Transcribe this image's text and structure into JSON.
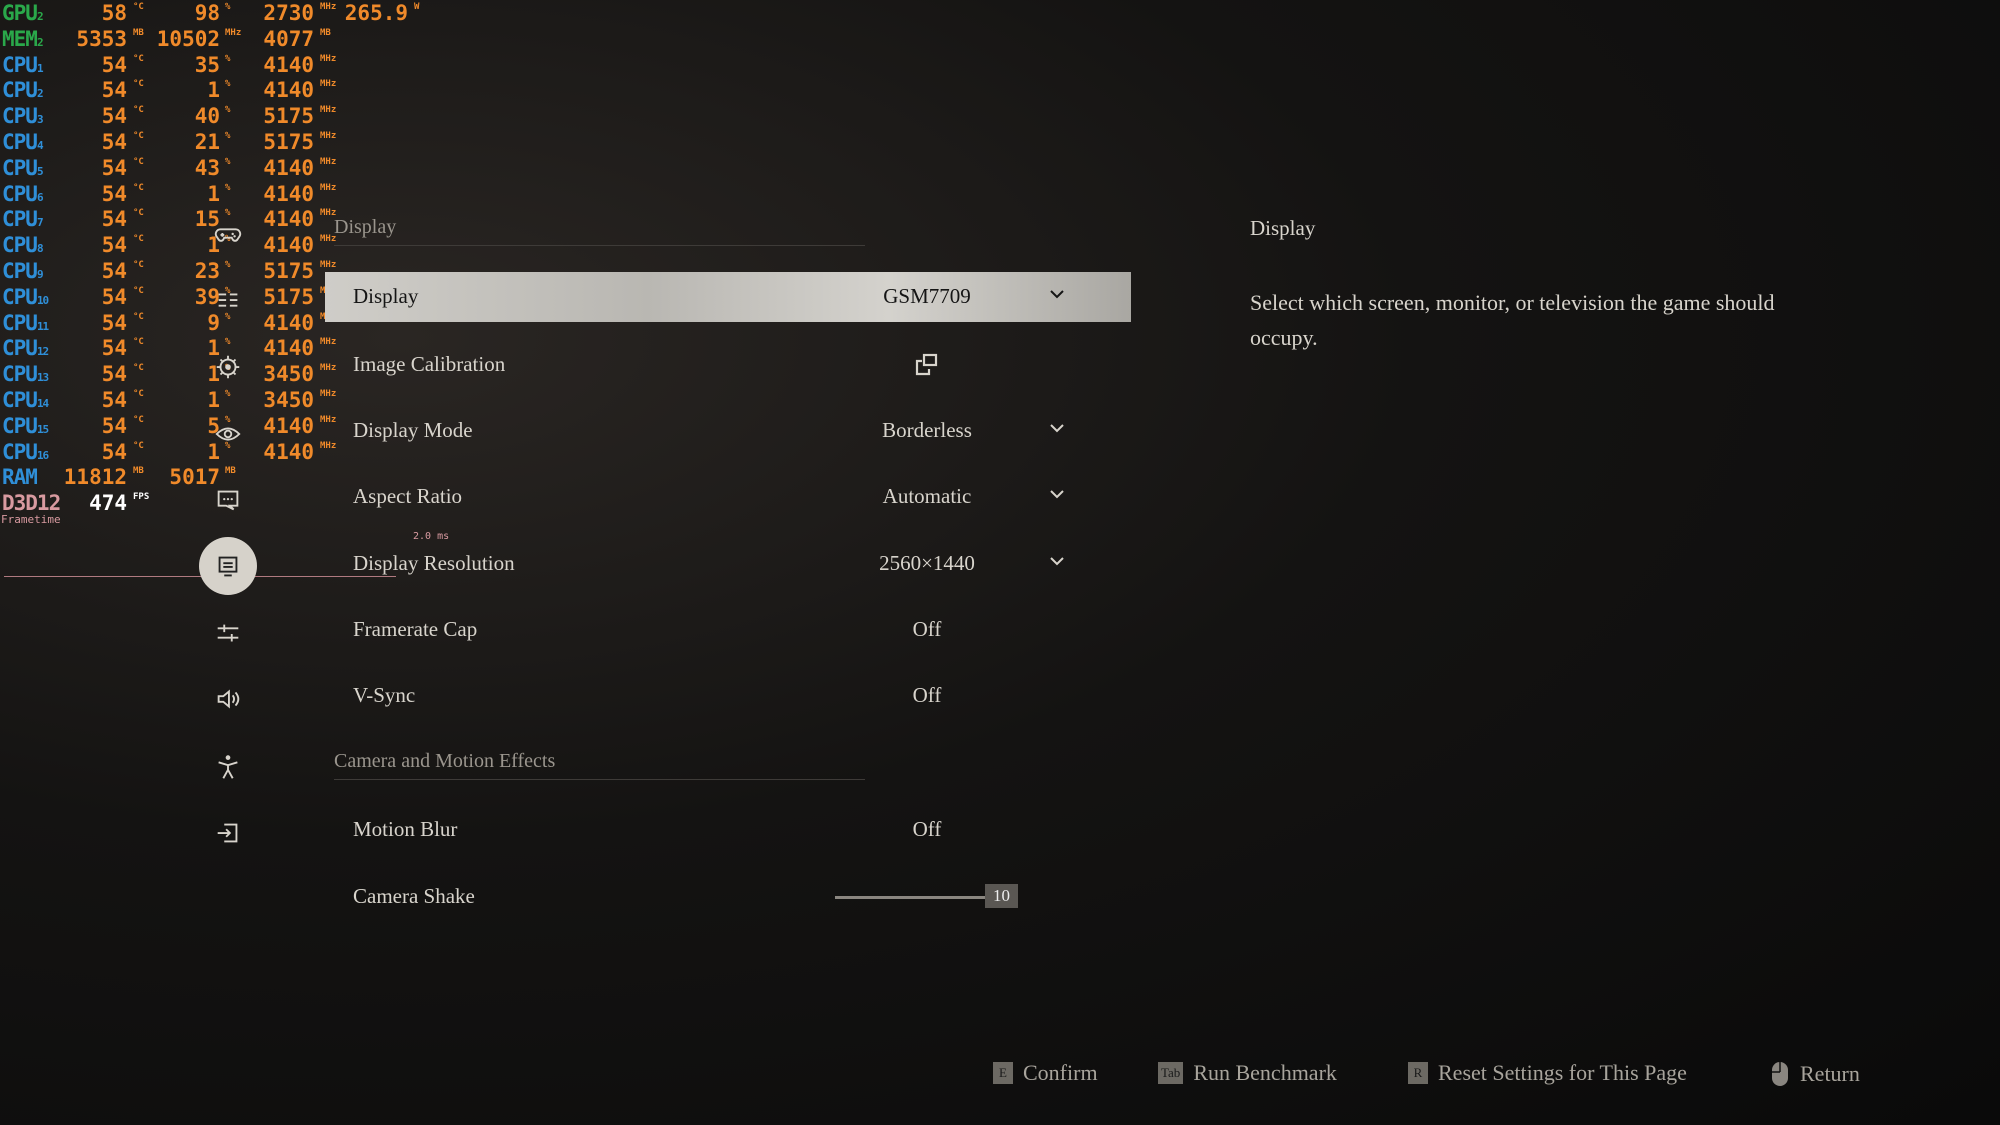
{
  "overlay": {
    "rows": [
      {
        "label": "GPU",
        "sub": "2",
        "label_color": "#2aa84a",
        "cols": [
          [
            "58",
            "°C"
          ],
          [
            "98",
            "%"
          ],
          [
            "2730",
            "MHz"
          ],
          [
            "265.9",
            "W"
          ]
        ]
      },
      {
        "label": "MEM",
        "sub": "2",
        "label_color": "#2aa84a",
        "cols": [
          [
            "5353",
            "MB"
          ],
          [
            "10502",
            "MHz"
          ],
          [
            "4077",
            "MB"
          ]
        ]
      },
      {
        "label": "CPU",
        "sub": "1",
        "label_color": "#2f8fd8",
        "cols": [
          [
            "54",
            "°C"
          ],
          [
            "35",
            "%"
          ],
          [
            "4140",
            "MHz"
          ]
        ]
      },
      {
        "label": "CPU",
        "sub": "2",
        "label_color": "#2f8fd8",
        "cols": [
          [
            "54",
            "°C"
          ],
          [
            "1",
            "%"
          ],
          [
            "4140",
            "MHz"
          ]
        ]
      },
      {
        "label": "CPU",
        "sub": "3",
        "label_color": "#2f8fd8",
        "cols": [
          [
            "54",
            "°C"
          ],
          [
            "40",
            "%"
          ],
          [
            "5175",
            "MHz"
          ]
        ]
      },
      {
        "label": "CPU",
        "sub": "4",
        "label_color": "#2f8fd8",
        "cols": [
          [
            "54",
            "°C"
          ],
          [
            "21",
            "%"
          ],
          [
            "5175",
            "MHz"
          ]
        ]
      },
      {
        "label": "CPU",
        "sub": "5",
        "label_color": "#2f8fd8",
        "cols": [
          [
            "54",
            "°C"
          ],
          [
            "43",
            "%"
          ],
          [
            "4140",
            "MHz"
          ]
        ]
      },
      {
        "label": "CPU",
        "sub": "6",
        "label_color": "#2f8fd8",
        "cols": [
          [
            "54",
            "°C"
          ],
          [
            "1",
            "%"
          ],
          [
            "4140",
            "MHz"
          ]
        ]
      },
      {
        "label": "CPU",
        "sub": "7",
        "label_color": "#2f8fd8",
        "cols": [
          [
            "54",
            "°C"
          ],
          [
            "15",
            "%"
          ],
          [
            "4140",
            "MHz"
          ]
        ]
      },
      {
        "label": "CPU",
        "sub": "8",
        "label_color": "#2f8fd8",
        "cols": [
          [
            "54",
            "°C"
          ],
          [
            "1",
            "%"
          ],
          [
            "4140",
            "MHz"
          ]
        ]
      },
      {
        "label": "CPU",
        "sub": "9",
        "label_color": "#2f8fd8",
        "cols": [
          [
            "54",
            "°C"
          ],
          [
            "23",
            "%"
          ],
          [
            "5175",
            "MHz"
          ]
        ]
      },
      {
        "label": "CPU",
        "sub": "10",
        "label_color": "#2f8fd8",
        "cols": [
          [
            "54",
            "°C"
          ],
          [
            "39",
            "%"
          ],
          [
            "5175",
            "MHz"
          ]
        ]
      },
      {
        "label": "CPU",
        "sub": "11",
        "label_color": "#2f8fd8",
        "cols": [
          [
            "54",
            "°C"
          ],
          [
            "9",
            "%"
          ],
          [
            "4140",
            "MHz"
          ]
        ]
      },
      {
        "label": "CPU",
        "sub": "12",
        "label_color": "#2f8fd8",
        "cols": [
          [
            "54",
            "°C"
          ],
          [
            "1",
            "%"
          ],
          [
            "4140",
            "MHz"
          ]
        ]
      },
      {
        "label": "CPU",
        "sub": "13",
        "label_color": "#2f8fd8",
        "cols": [
          [
            "54",
            "°C"
          ],
          [
            "1",
            "%"
          ],
          [
            "3450",
            "MHz"
          ]
        ]
      },
      {
        "label": "CPU",
        "sub": "14",
        "label_color": "#2f8fd8",
        "cols": [
          [
            "54",
            "°C"
          ],
          [
            "1",
            "%"
          ],
          [
            "3450",
            "MHz"
          ]
        ]
      },
      {
        "label": "CPU",
        "sub": "15",
        "label_color": "#2f8fd8",
        "cols": [
          [
            "54",
            "°C"
          ],
          [
            "5",
            "%"
          ],
          [
            "4140",
            "MHz"
          ]
        ]
      },
      {
        "label": "CPU",
        "sub": "16",
        "label_color": "#2f8fd8",
        "cols": [
          [
            "54",
            "°C"
          ],
          [
            "1",
            "%"
          ],
          [
            "4140",
            "MHz"
          ]
        ]
      },
      {
        "label": "RAM",
        "sub": "",
        "label_color": "#2f8fd8",
        "cols": [
          [
            "11812",
            "MB"
          ],
          [
            "5017",
            "MB"
          ]
        ]
      },
      {
        "label": "D3D12",
        "sub": "",
        "label_color": "#d89aa0",
        "cols": [
          [
            "474",
            "FPS"
          ]
        ],
        "white": true
      }
    ],
    "frametime_label": "Frametime",
    "frametime_value": "2.0 ms"
  },
  "sidebar": {
    "icons": [
      "gamepad-icon",
      "controls-list-icon",
      "gear-icon",
      "eye-icon",
      "chat-icon",
      "display-icon",
      "sliders-icon",
      "speaker-icon",
      "accessibility-icon",
      "exit-icon"
    ],
    "selected": 5
  },
  "main": {
    "section1": "Display",
    "rows": [
      {
        "label": "Display",
        "value": "GSM7709",
        "type": "dropdown"
      },
      {
        "label": "Image Calibration",
        "value": "",
        "type": "external"
      },
      {
        "label": "Display Mode",
        "value": "Borderless",
        "type": "dropdown"
      },
      {
        "label": "Aspect Ratio",
        "value": "Automatic",
        "type": "dropdown"
      },
      {
        "label": "Display Resolution",
        "value": "2560×1440",
        "type": "dropdown"
      },
      {
        "label": "Framerate Cap",
        "value": "Off",
        "type": "toggle"
      },
      {
        "label": "V-Sync",
        "value": "Off",
        "type": "toggle"
      }
    ],
    "section2": "Camera and Motion Effects",
    "rows2": [
      {
        "label": "Motion Blur",
        "value": "Off",
        "type": "toggle"
      },
      {
        "label": "Camera Shake",
        "value": "10",
        "type": "slider",
        "level": 1.0
      }
    ]
  },
  "info": {
    "title": "Display",
    "description": "Select which screen, monitor, or television the game should occupy."
  },
  "footer": [
    {
      "key": "E",
      "label": "Confirm"
    },
    {
      "key": "Tab",
      "label": "Run Benchmark"
    },
    {
      "key": "R",
      "label": "Reset Settings for This Page"
    },
    {
      "key": "mouse",
      "label": "Return"
    }
  ]
}
